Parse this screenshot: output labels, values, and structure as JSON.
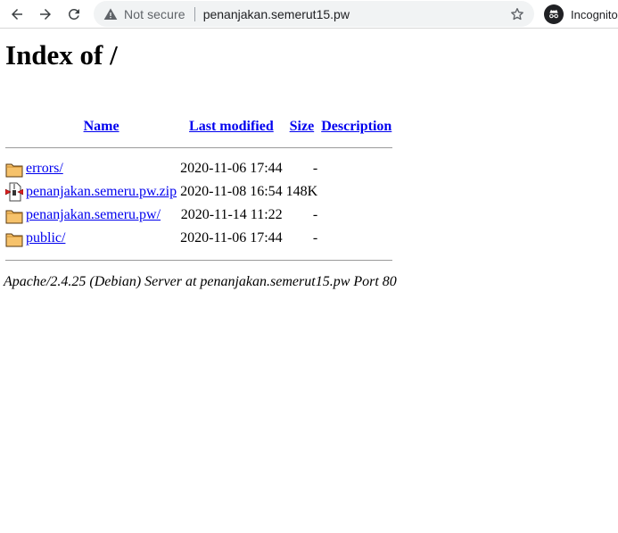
{
  "browser": {
    "security_label": "Not secure",
    "url": "penanjakan.semerut15.pw",
    "incognito_label": "Incognito",
    "icons": [
      "back-arrow-icon",
      "forward-arrow-icon",
      "reload-icon",
      "warning-icon",
      "star-icon",
      "incognito-icon"
    ]
  },
  "page": {
    "title": "Index of /",
    "columns": {
      "name": "Name",
      "last_modified": "Last modified",
      "size": "Size",
      "description": "Description"
    },
    "rows": [
      {
        "name": "errors/",
        "modified": "2020-11-06 17:44",
        "size": "-",
        "icon": "folder-icon"
      },
      {
        "name": "penanjakan.semeru.pw.zip",
        "modified": "2020-11-08 16:54",
        "size": "148K",
        "icon": "compressed-file-icon"
      },
      {
        "name": "penanjakan.semeru.pw/",
        "modified": "2020-11-14 11:22",
        "size": "-",
        "icon": "folder-icon"
      },
      {
        "name": "public/",
        "modified": "2020-11-06 17:44",
        "size": "-",
        "icon": "folder-icon"
      }
    ],
    "server_signature": "Apache/2.4.25 (Debian) Server at penanjakan.semerut15.pw Port 80"
  },
  "colors": {
    "link": "#0000ee",
    "omnibox_bg": "#f1f3f4",
    "folder_fill": "#f6c26b"
  }
}
